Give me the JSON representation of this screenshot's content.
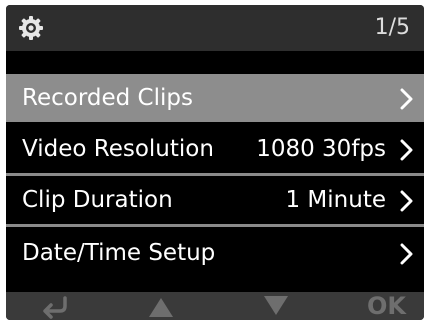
{
  "status": {
    "page_indicator": "1/5",
    "icon": "gear-icon"
  },
  "menu": {
    "items": [
      {
        "label": "Recorded Clips",
        "value": "",
        "selected": true
      },
      {
        "label": "Video Resolution",
        "value": "1080 30fps",
        "selected": false
      },
      {
        "label": "Clip Duration",
        "value": "1 Minute",
        "selected": false
      },
      {
        "label": "Date/Time Setup",
        "value": "",
        "selected": false
      }
    ]
  },
  "footer": {
    "back_icon": "return-arrow-icon",
    "up_icon": "triangle-up-icon",
    "down_icon": "triangle-down-icon",
    "ok_label": "OK"
  },
  "colors": {
    "selected_row": "#8d8d8d",
    "background": "#000000",
    "status_bar": "#2e2e2e",
    "footer_bar": "#3a3a3a",
    "footer_icons": "#6e6e6e"
  }
}
